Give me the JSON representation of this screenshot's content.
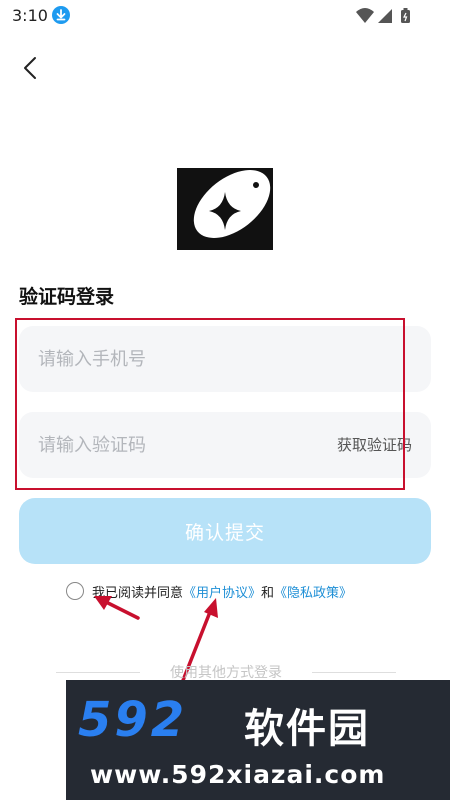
{
  "status_bar": {
    "time": "3:10"
  },
  "page": {
    "title": "验证码登录"
  },
  "form": {
    "phone_placeholder": "请输入手机号",
    "code_placeholder": "请输入验证码",
    "get_code_label": "获取验证码",
    "submit_label": "确认提交"
  },
  "agreement": {
    "prefix": "我已阅读并同意",
    "user_agreement": "《用户协议》",
    "conjunction": "和",
    "privacy_policy": "《隐私政策》"
  },
  "other_login": {
    "label": "使用其他方式登录"
  },
  "watermark": {
    "brand_number": "592",
    "brand_name": "软件园",
    "url": "www.592xiazai.com"
  },
  "colors": {
    "accent": "#1e8fd6",
    "submit_disabled": "#b7e2f8",
    "annotation": "#c8102e",
    "input_bg": "#f5f6f8"
  }
}
